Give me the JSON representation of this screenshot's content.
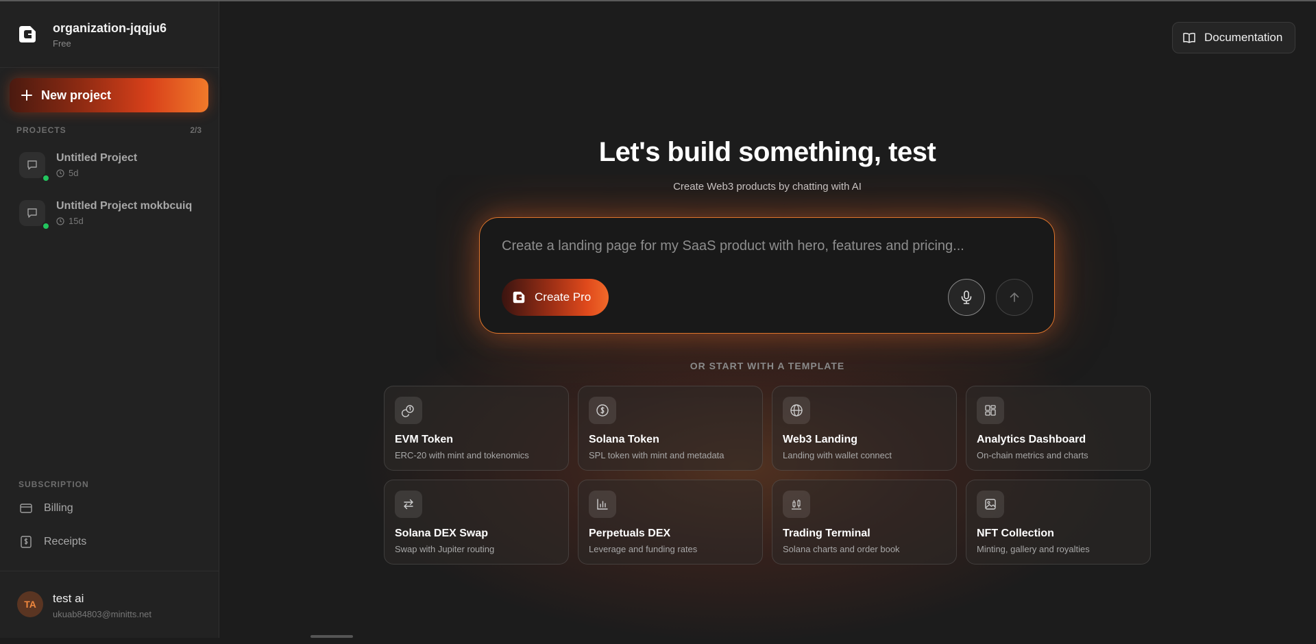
{
  "org": {
    "name": "organization-jqqju6",
    "plan": "Free"
  },
  "sidebar": {
    "new_project_label": "New project",
    "projects_heading": "PROJECTS",
    "projects_count": "2/3",
    "projects": [
      {
        "title": "Untitled Project",
        "age": "5d"
      },
      {
        "title": "Untitled Project mokbcuiq",
        "age": "15d"
      }
    ],
    "subscription_heading": "SUBSCRIPTION",
    "links": [
      {
        "label": "Billing",
        "icon": "credit-card-icon"
      },
      {
        "label": "Receipts",
        "icon": "receipt-icon"
      }
    ]
  },
  "user": {
    "initials": "TA",
    "name": "test ai",
    "email": "ukuab84803@minitts.net"
  },
  "header": {
    "docs_label": "Documentation"
  },
  "hero": {
    "title": "Let's build something, test",
    "subtitle": "Create Web3 products by chatting with AI"
  },
  "prompt": {
    "placeholder": "Create a landing page for my SaaS product with hero, features and pricing...",
    "mode_label": "Create Pro"
  },
  "templates": {
    "heading": "OR START WITH A TEMPLATE",
    "items": [
      {
        "title": "EVM Token",
        "desc": "ERC-20 with mint and tokenomics",
        "icon": "coins-icon"
      },
      {
        "title": "Solana Token",
        "desc": "SPL token with mint and metadata",
        "icon": "dollar-circle-icon"
      },
      {
        "title": "Web3 Landing",
        "desc": "Landing with wallet connect",
        "icon": "globe-icon"
      },
      {
        "title": "Analytics Dashboard",
        "desc": "On-chain metrics and charts",
        "icon": "dashboard-icon"
      },
      {
        "title": "Solana DEX Swap",
        "desc": "Swap with Jupiter routing",
        "icon": "swap-arrows-icon"
      },
      {
        "title": "Perpetuals DEX",
        "desc": "Leverage and funding rates",
        "icon": "bar-chart-icon"
      },
      {
        "title": "Trading Terminal",
        "desc": "Solana charts and order book",
        "icon": "candlestick-icon"
      },
      {
        "title": "NFT Collection",
        "desc": "Minting, gallery and royalties",
        "icon": "image-icon"
      }
    ]
  },
  "colors": {
    "accent": "#e04a1c",
    "accent_light": "#f07a2a",
    "online": "#22c55e",
    "background": "#1c1c1c",
    "sidebar": "#222222"
  }
}
